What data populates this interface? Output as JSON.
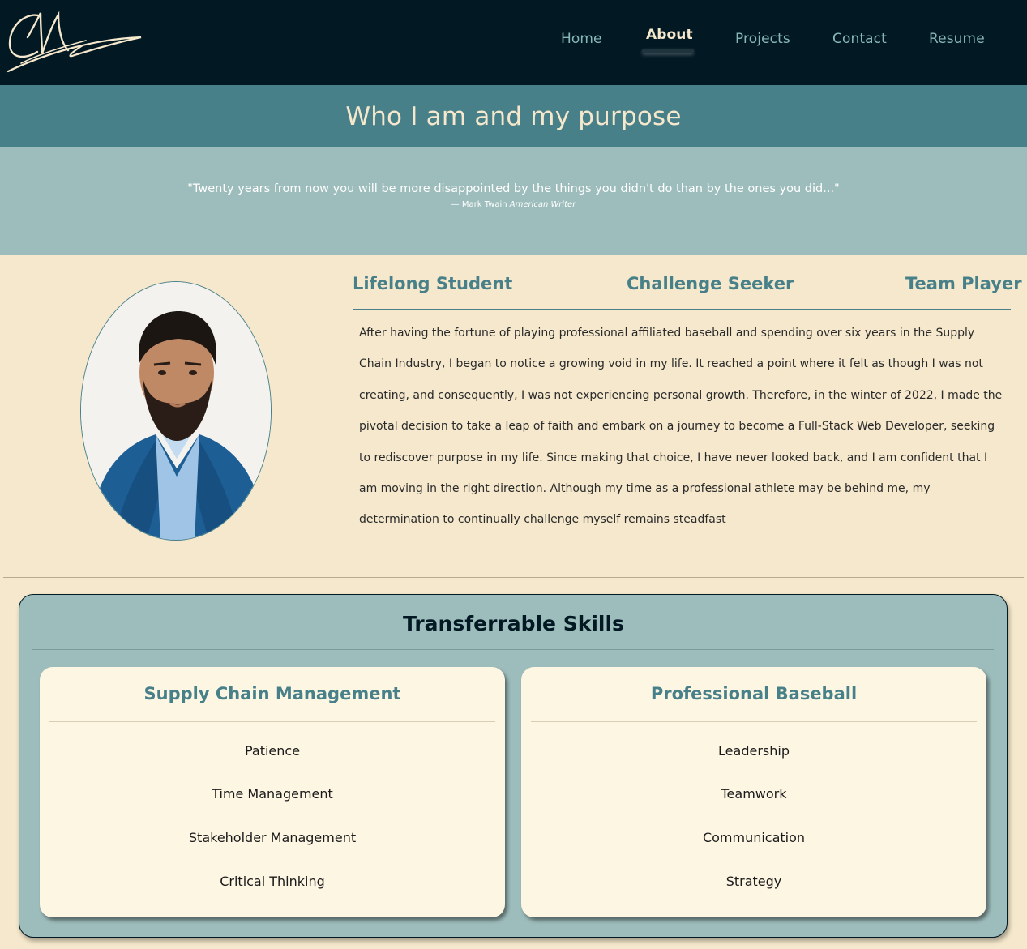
{
  "nav": {
    "items": [
      {
        "label": "Home",
        "active": false
      },
      {
        "label": "About",
        "active": true
      },
      {
        "label": "Projects",
        "active": false
      },
      {
        "label": "Contact",
        "active": false
      },
      {
        "label": "Resume",
        "active": false
      }
    ]
  },
  "colors": {
    "navbar_bg": "#021823",
    "accent_teal": "#48808a",
    "light_teal": "#9dbdbc",
    "cream": "#f5e8cc",
    "card_bg": "#fdf6e3"
  },
  "hero": {
    "title": "Who I am and my purpose"
  },
  "quote": {
    "text": "\"Twenty years from now you will be more disappointed by the things you didn't do than by the ones you did...\"",
    "author": "— Mark Twain",
    "author_title": "American Writer"
  },
  "about": {
    "traits": [
      "Lifelong Student",
      "Challenge Seeker",
      "Team Player"
    ],
    "bio": "After having the fortune of playing professional affiliated baseball and spending over six years in the Supply Chain Industry, I began to notice a growing void in my life. It reached a point where it felt as though I was not creating, and consequently, I was not experiencing personal growth. Therefore, in the winter of 2022, I made the pivotal decision to take a leap of faith and embark on a journey to become a Full-Stack Web Developer, seeking to rediscover purpose in my life. Since making that choice, I have never looked back, and I am confident that I am moving in the right direction. Although my time as a professional athlete may be behind me, my determination to continually challenge myself remains steadfast"
  },
  "skills": {
    "title": "Transferrable Skills",
    "cards": [
      {
        "title": "Supply Chain Management",
        "items": [
          "Patience",
          "Time Management",
          "Stakeholder Management",
          "Critical Thinking"
        ]
      },
      {
        "title": "Professional Baseball",
        "items": [
          "Leadership",
          "Teamwork",
          "Communication",
          "Strategy"
        ]
      }
    ]
  }
}
